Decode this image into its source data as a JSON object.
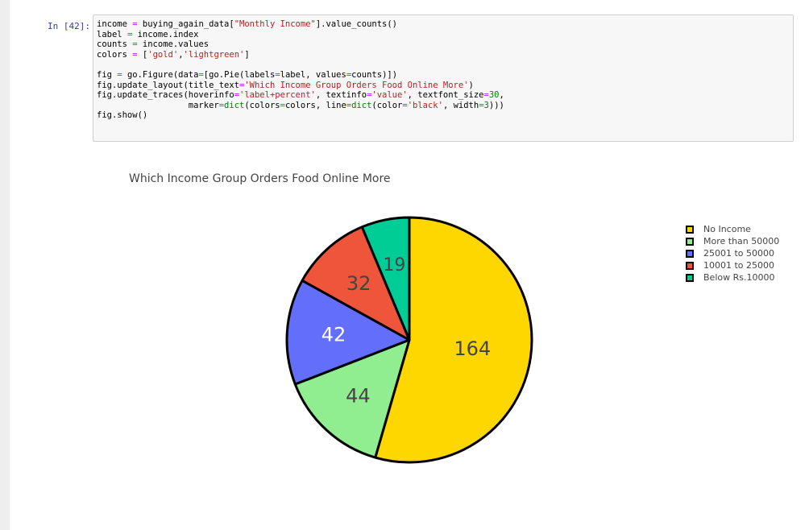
{
  "cell": {
    "prompt": "In [42]:",
    "code_lines": [
      "income = buying_again_data[\"Monthly Income\"].value_counts()",
      "label = income.index",
      "counts = income.values",
      "colors = ['gold','lightgreen']",
      "",
      "fig = go.Figure(data=[go.Pie(labels=label, values=counts)])",
      "fig.update_layout(title_text='Which Income Group Orders Food Online More')",
      "fig.update_traces(hoverinfo='label+percent', textinfo='value', textfont_size=30,",
      "                  marker=dict(colors=colors, line=dict(color='black', width=3)))",
      "fig.show()"
    ]
  },
  "chart_data": {
    "type": "pie",
    "title": "Which Income Group Orders Food Online More",
    "categories": [
      "No Income",
      "More than 50000",
      "25001 to 50000",
      "10001 to 25000",
      "Below Rs.10000"
    ],
    "values": [
      164,
      44,
      42,
      32,
      19
    ],
    "colors": [
      "#ffd700",
      "#90ee90",
      "#636efa",
      "#ef553b",
      "#00cc96"
    ],
    "label_colors": [
      "#444444",
      "#444444",
      "#ffffff",
      "#444444",
      "#444444"
    ],
    "legend": "top-right",
    "direction": "clockwise",
    "outline_color": "#000000"
  }
}
